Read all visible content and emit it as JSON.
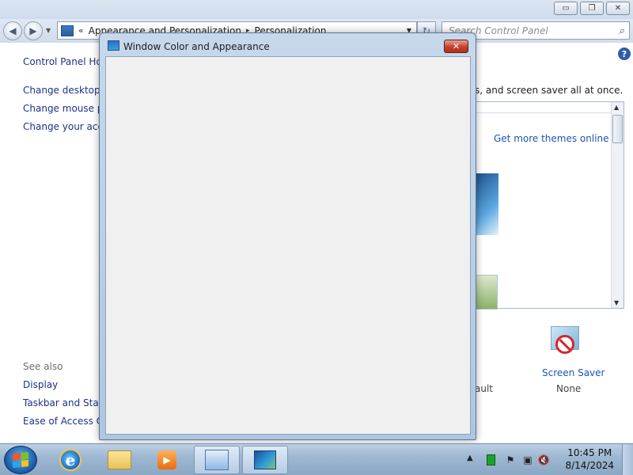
{
  "main_window": {
    "window_controls": {
      "minimize": "▭",
      "maximize": "❐",
      "close": "✕"
    },
    "nav": {
      "back_icon": "◀",
      "forward_icon": "▶",
      "breadcrumb_prefix": "«",
      "breadcrumb": [
        "Appearance and Personalization",
        "Personalization"
      ],
      "breadcrumb_separator": "▸",
      "refresh_icon": "↻",
      "search_placeholder": "Search Control Panel"
    },
    "help_label": "?",
    "left_pane": {
      "home": "Control Panel Home",
      "links": [
        "Change desktop icons",
        "Change mouse pointers",
        "Change your account picture"
      ],
      "see_also_title": "See also",
      "see_also_links": [
        "Display",
        "Taskbar and Start Menu",
        "Ease of Access Center"
      ]
    },
    "content": {
      "description": "s, and screen saver all at once.",
      "get_more_themes": "Get more themes online",
      "ultimate_partial": "ault",
      "screen_saver_label": "Screen Saver",
      "screen_saver_value": "None"
    }
  },
  "dialog": {
    "title": "Window Color and Appearance",
    "close_label": "✕"
  },
  "taskbar": {
    "items": [
      "Internet Explorer",
      "Windows Explorer",
      "Windows Media Player",
      "Control Panel",
      "Window Color and Appearance"
    ],
    "tray": {
      "show_hidden": "▲",
      "flag": "⚑",
      "network": "▣",
      "volume": "🔇"
    },
    "clock": {
      "time": "10:45 PM",
      "date": "8/14/2024"
    }
  },
  "colors": {
    "link": "#1e3287",
    "accent_link": "#1e55b0",
    "dialog_frame": "#aec6e0",
    "dialog_client": "#f0f0f0",
    "taskbar": "#9fb8d2",
    "close_red": "#c6412b"
  }
}
